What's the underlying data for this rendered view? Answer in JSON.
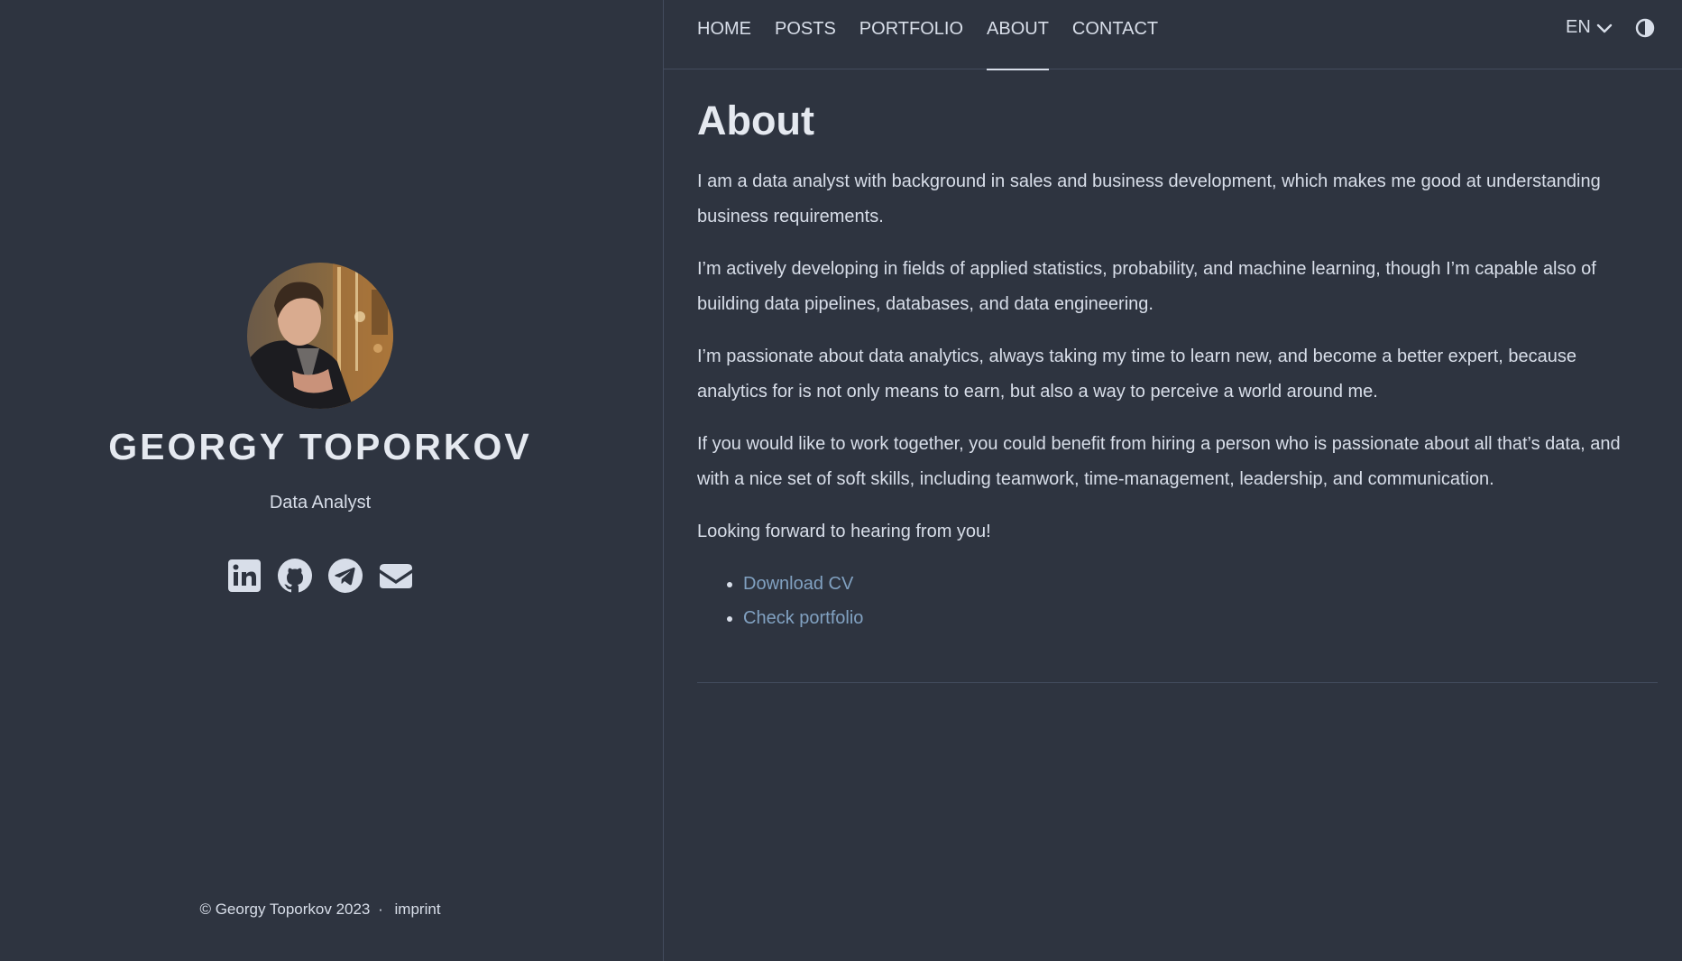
{
  "nav": {
    "items": [
      {
        "label": "HOME",
        "active": false
      },
      {
        "label": "POSTS",
        "active": false
      },
      {
        "label": "PORTFOLIO",
        "active": false
      },
      {
        "label": "ABOUT",
        "active": true
      },
      {
        "label": "CONTACT",
        "active": false
      }
    ],
    "language": "EN"
  },
  "profile": {
    "name": "GEORGY TOPORKOV",
    "role": "Data Analyst",
    "socials": [
      {
        "icon": "linkedin-icon"
      },
      {
        "icon": "github-icon"
      },
      {
        "icon": "telegram-icon"
      },
      {
        "icon": "email-icon"
      }
    ]
  },
  "footer": {
    "copyright": "© Georgy Toporkov 2023",
    "separator": "·",
    "imprint": "imprint"
  },
  "page": {
    "title": "About",
    "paragraphs": [
      "I am a data analyst with background in sales and business development, which makes me good at understanding business requirements.",
      "I’m actively developing in fields of applied statistics, probability, and machine learning, though I’m capable also of building data pipelines, databases, and data engineering.",
      "I’m passionate about data analytics, always taking my time to learn new, and become a better expert, because analytics for is not only means to earn, but also a way to perceive a world around me.",
      "If you would like to work together, you could benefit from hiring a person who is passionate about all that’s data, and with a nice set of soft skills, including teamwork, time-management, leadership, and communication.",
      "Looking forward to hearing from you!"
    ],
    "links": [
      "Download CV",
      "Check portfolio"
    ]
  },
  "colors": {
    "background": "#2e3440",
    "text": "#d8dee9",
    "link": "#81a1c1",
    "border": "#434c5e"
  }
}
